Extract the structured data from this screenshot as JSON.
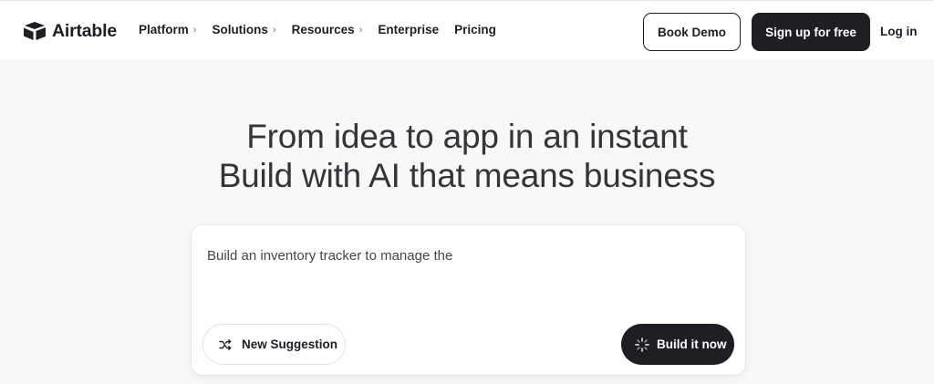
{
  "header": {
    "brand": "Airtable",
    "nav": [
      {
        "label": "Platform",
        "chevron": "›"
      },
      {
        "label": "Solutions",
        "chevron": "›"
      },
      {
        "label": "Resources",
        "chevron": "›"
      },
      {
        "label": "Enterprise",
        "chevron": ""
      },
      {
        "label": "Pricing",
        "chevron": ""
      }
    ],
    "book_demo": "Book Demo",
    "signup": "Sign up for free",
    "login": "Log in"
  },
  "hero": {
    "line1": "From idea to app in an instant",
    "line2": "Build with AI that means business"
  },
  "prompt": {
    "text": "Build an inventory tracker to manage the",
    "suggestion_button": "New Suggestion",
    "suggestion_icon": "shuffle-icon",
    "build_button": "Build it now",
    "build_icon": "spinner-icon"
  },
  "colors": {
    "primary_dark": "#1d1f25",
    "page_background": "#f8f8f8"
  }
}
